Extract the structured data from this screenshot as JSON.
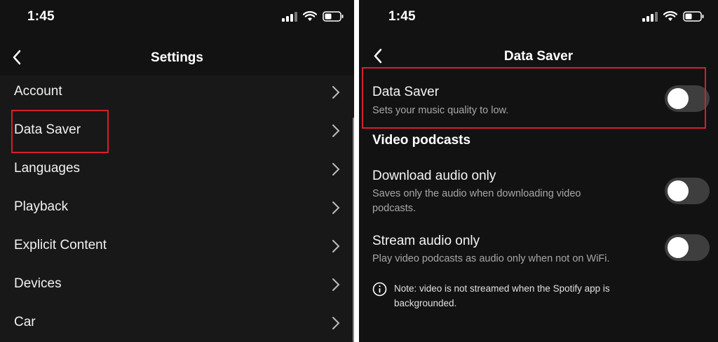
{
  "left": {
    "status_time": "1:45",
    "title": "Settings",
    "items": [
      {
        "label": "Account"
      },
      {
        "label": "Data Saver"
      },
      {
        "label": "Languages"
      },
      {
        "label": "Playback"
      },
      {
        "label": "Explicit Content"
      },
      {
        "label": "Devices"
      },
      {
        "label": "Car"
      }
    ]
  },
  "right": {
    "status_time": "1:45",
    "title": "Data Saver",
    "data_saver": {
      "title": "Data Saver",
      "desc": "Sets your music quality to low.",
      "enabled": false
    },
    "section": "Video podcasts",
    "download_audio": {
      "title": "Download audio only",
      "desc": "Saves only the audio when downloading video podcasts.",
      "enabled": false
    },
    "stream_audio": {
      "title": "Stream audio only",
      "desc": "Play video podcasts as audio only when not on WiFi.",
      "enabled": false
    },
    "note": "Note: video is not streamed when the Spotify app is backgrounded."
  },
  "colors": {
    "background": "#121212",
    "highlight": "#d4202b",
    "toggle_off": "#3e3e3e"
  }
}
